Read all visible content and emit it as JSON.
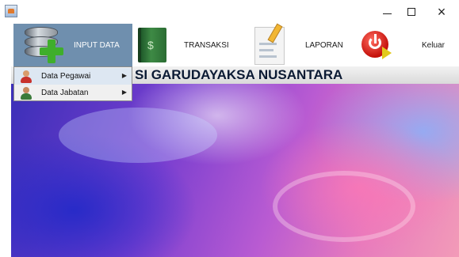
{
  "menu": {
    "input": "INPUT DATA",
    "transaksi": "TRANSAKSI",
    "laporan": "LAPORAN",
    "keluar": "Keluar"
  },
  "banner": {
    "title": "SI GARUDAYAKSA NUSANTARA"
  },
  "dropdown": {
    "items": [
      {
        "label": "Data Pegawai",
        "icon": "person-red-icon"
      },
      {
        "label": "Data Jabatan",
        "icon": "person-green-icon"
      }
    ]
  },
  "icons": {
    "input": "database-add-icon",
    "transaksi": "money-book-icon",
    "laporan": "document-pencil-icon",
    "keluar": "power-exit-icon"
  },
  "colors": {
    "menu_active": "#6f8fae",
    "dropdown_bg": "#f0f0f0",
    "banner_text": "#0b1a33"
  }
}
